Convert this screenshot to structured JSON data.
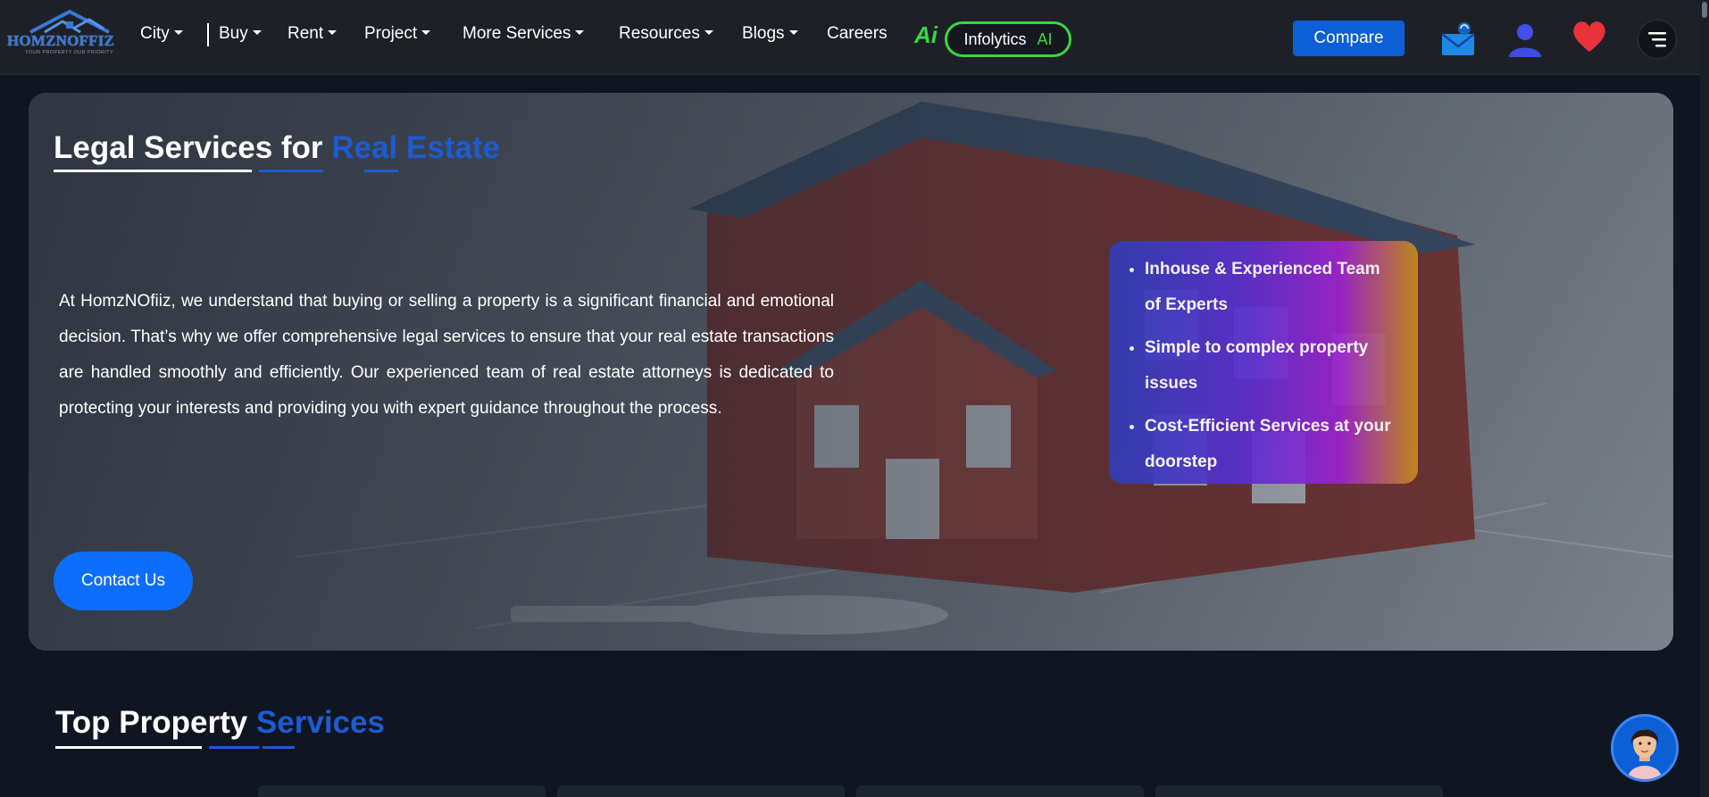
{
  "logo": {
    "brand": "HOMZNOFFIZ",
    "tagline": "YOUR PROPERTY OUR PRIORITY"
  },
  "nav": {
    "city": "City",
    "buy": "Buy",
    "rent": "Rent",
    "project": "Project",
    "more_services": "More Services",
    "resources": "Resources",
    "blogs": "Blogs",
    "careers": "Careers"
  },
  "ai_badge": {
    "glyph": "Ai",
    "label": "Infolytics",
    "tag": "AI"
  },
  "header_actions": {
    "compare": "Compare"
  },
  "hero": {
    "title_main": "Legal Services for ",
    "title_accent": "Real Estate",
    "description": "At HomzNOfiiz, we understand that buying or selling a property is a significant financial and emotional decision. That’s why we offer comprehensive legal services to ensure that your real estate transactions are handled smoothly and efficiently. Our experienced team of real estate attorneys is dedicated to protecting your interests and providing you with expert guidance throughout the process.",
    "features": [
      "Inhouse & Experienced Team of Experts",
      "Simple to complex property issues",
      "Cost-Efficient Services at your doorstep"
    ],
    "contact_button": "Contact Us"
  },
  "services_section": {
    "title_main": "Top Property ",
    "title_accent": "Services"
  },
  "colors": {
    "accent_blue": "#1d5bd1",
    "button_blue": "#0d6efd",
    "ai_green": "#38d641",
    "heart_red": "#e8333a",
    "nav_bg": "#1d2127",
    "page_bg": "#0f1622"
  },
  "icons": [
    "mail-icon",
    "user-icon",
    "heart-icon",
    "menu-icon",
    "chat-avatar-icon"
  ]
}
